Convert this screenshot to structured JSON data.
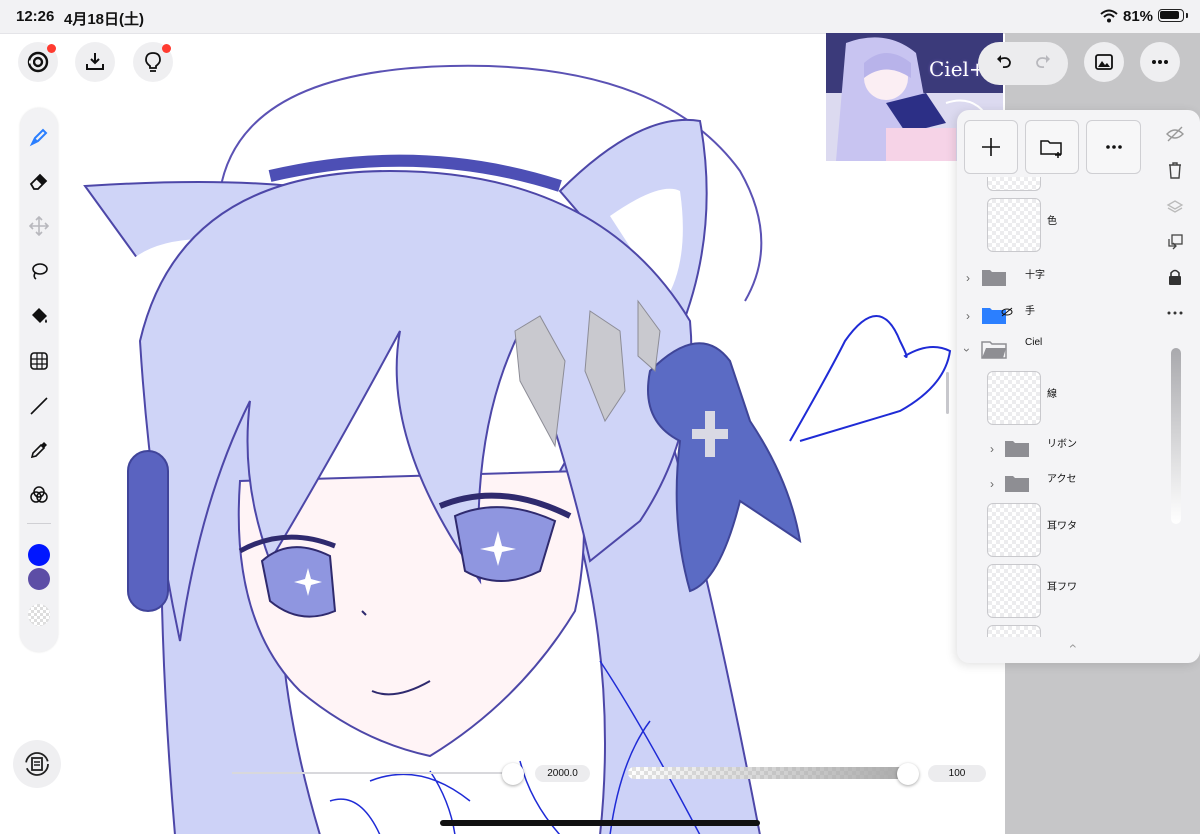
{
  "status_bar": {
    "time": "12:26",
    "date": "4月18日(土)",
    "battery": "81%"
  },
  "top_left": [
    {
      "name": "gallery-icon",
      "badge": true
    },
    {
      "name": "import-icon",
      "badge": false
    },
    {
      "name": "tips-lightbulb-icon",
      "badge": true
    }
  ],
  "tools": [
    "pen-icon",
    "eraser-icon",
    "move-icon",
    "lasso-icon",
    "fill-bucket-icon",
    "transform-grid-icon",
    "line-icon",
    "eyedropper-icon",
    "color-blend-icon"
  ],
  "colors": {
    "primary": "#0016ff",
    "secondary": "#5d4ea6",
    "accent": "#2b7fff"
  },
  "reference": {
    "title": "Ciel+"
  },
  "layers": [
    {
      "name": "色",
      "type": "layer"
    },
    {
      "name": "十字",
      "type": "folder",
      "collapsed": true
    },
    {
      "name": "手",
      "type": "folder",
      "collapsed": true,
      "selected": true,
      "hidden": true
    },
    {
      "name": "Ciel",
      "type": "folder",
      "collapsed": false
    },
    {
      "name": "線",
      "type": "layer",
      "indent": true
    },
    {
      "name": "リボン",
      "type": "folder",
      "collapsed": true,
      "indent": true
    },
    {
      "name": "アクセ",
      "type": "folder",
      "collapsed": true,
      "indent": true
    },
    {
      "name": "耳ワタ",
      "type": "layer",
      "indent": true
    },
    {
      "name": "耳フワ",
      "type": "layer",
      "indent": true
    }
  ],
  "brush": {
    "size": "2000.0",
    "opacity": "100",
    "size_fraction": 0.98,
    "opacity_fraction": 0.98
  }
}
